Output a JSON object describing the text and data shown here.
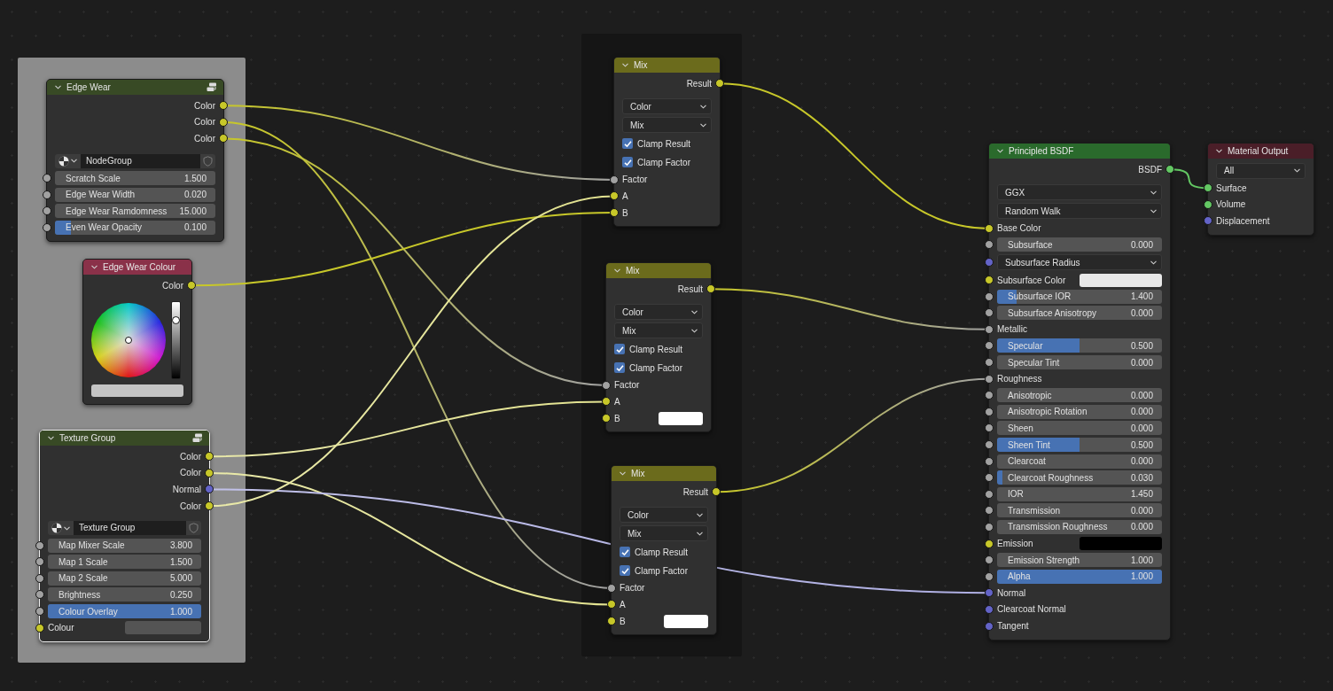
{
  "frames": [
    {
      "kind": "light"
    },
    {
      "kind": "dark"
    }
  ],
  "nodes": [
    {
      "title": "Edge Wear",
      "kind": "group",
      "selected": false,
      "group_icon": true,
      "rows": [
        {
          "kind": "output",
          "label": "Color",
          "socket": {
            "color": "#c7c729"
          }
        },
        {
          "kind": "output",
          "label": "Color",
          "socket": {
            "color": "#c7c729"
          }
        },
        {
          "kind": "output",
          "label": "Color",
          "socket": {
            "color": "#c7c729"
          }
        },
        {
          "kind": "selector",
          "name": "NodeGroup"
        },
        {
          "kind": "number",
          "label": "Scratch Scale",
          "value": "1.500",
          "socket": {
            "color": "#a1a1a1"
          }
        },
        {
          "kind": "number",
          "label": "Edge Wear Width",
          "value": "0.020",
          "socket": {
            "color": "#a1a1a1"
          }
        },
        {
          "kind": "number",
          "label": "Edge Wear Ramdomness",
          "value": "15.000",
          "socket": {
            "color": "#a1a1a1"
          }
        },
        {
          "kind": "slider",
          "label": "Even Wear Opacity",
          "value": "0.100",
          "level": 0.1,
          "socket": {
            "color": "#a1a1a1"
          }
        }
      ]
    },
    {
      "title": "Edge Wear Colour",
      "kind": "input",
      "selected": false,
      "group_icon": false,
      "rows": [
        {
          "kind": "output",
          "label": "Color",
          "socket": {
            "color": "#c7c729"
          }
        },
        {
          "kind": "wheel",
          "level": 0.75,
          "swatch": {
            "color": "#c4c4c4"
          }
        }
      ]
    },
    {
      "title": "Texture Group",
      "kind": "group",
      "selected": true,
      "group_icon": true,
      "rows": [
        {
          "kind": "output",
          "label": "Color",
          "socket": {
            "color": "#c7c729"
          }
        },
        {
          "kind": "output",
          "label": "Color",
          "socket": {
            "color": "#c7c729"
          }
        },
        {
          "kind": "output",
          "label": "Normal",
          "socket": {
            "color": "#6363c7"
          }
        },
        {
          "kind": "output",
          "label": "Color",
          "socket": {
            "color": "#c7c729"
          }
        },
        {
          "kind": "selector",
          "name": "Texture Group"
        },
        {
          "kind": "number",
          "label": "Map Mixer Scale",
          "value": "3.800",
          "socket": {
            "color": "#a1a1a1"
          }
        },
        {
          "kind": "number",
          "label": "Map 1 Scale",
          "value": "1.500",
          "socket": {
            "color": "#a1a1a1"
          }
        },
        {
          "kind": "number",
          "label": "Map 2 Scale",
          "value": "5.000",
          "socket": {
            "color": "#a1a1a1"
          }
        },
        {
          "kind": "number",
          "label": "Brightness",
          "value": "0.250",
          "socket": {
            "color": "#a1a1a1"
          }
        },
        {
          "kind": "slider",
          "label": "Colour Overlay",
          "value": "1.000",
          "level": 1.0,
          "socket": {
            "color": "#a1a1a1"
          }
        },
        {
          "kind": "color_input",
          "label": "Colour",
          "swatch": {
            "color": "#545454"
          },
          "socket": {
            "color": "#c7c729"
          }
        }
      ]
    },
    {
      "title": "Mix",
      "kind": "converter",
      "selected": false,
      "group_icon": false,
      "rows": [
        {
          "kind": "output",
          "label": "Result",
          "socket": {
            "color": "#c7c729"
          }
        },
        {
          "kind": "dropdown",
          "value": "Color"
        },
        {
          "kind": "dropdown",
          "value": "Mix"
        },
        {
          "kind": "checkbox",
          "label": "Clamp Result",
          "checked": true
        },
        {
          "kind": "checkbox",
          "label": "Clamp Factor",
          "checked": true
        },
        {
          "kind": "input",
          "label": "Factor",
          "socket": {
            "color": "#a1a1a1"
          }
        },
        {
          "kind": "input",
          "label": "A",
          "socket": {
            "color": "#c7c729"
          }
        },
        {
          "kind": "input",
          "label": "B",
          "socket": {
            "color": "#c7c729"
          }
        }
      ]
    },
    {
      "title": "Mix",
      "kind": "converter",
      "selected": false,
      "group_icon": false,
      "rows": [
        {
          "kind": "output",
          "label": "Result",
          "socket": {
            "color": "#c7c729"
          }
        },
        {
          "kind": "dropdown",
          "value": "Color"
        },
        {
          "kind": "dropdown",
          "value": "Mix"
        },
        {
          "kind": "checkbox",
          "label": "Clamp Result",
          "checked": true
        },
        {
          "kind": "checkbox",
          "label": "Clamp Factor",
          "checked": true
        },
        {
          "kind": "input",
          "label": "Factor",
          "socket": {
            "color": "#a1a1a1"
          }
        },
        {
          "kind": "input",
          "label": "A",
          "socket": {
            "color": "#c7c729"
          }
        },
        {
          "kind": "color_input",
          "label": "B",
          "swatch": {
            "color": "#ffffff"
          },
          "socket": {
            "color": "#c7c729"
          }
        }
      ]
    },
    {
      "title": "Mix",
      "kind": "converter",
      "selected": false,
      "group_icon": false,
      "rows": [
        {
          "kind": "output",
          "label": "Result",
          "socket": {
            "color": "#c7c729"
          }
        },
        {
          "kind": "dropdown",
          "value": "Color"
        },
        {
          "kind": "dropdown",
          "value": "Mix"
        },
        {
          "kind": "checkbox",
          "label": "Clamp Result",
          "checked": true
        },
        {
          "kind": "checkbox",
          "label": "Clamp Factor",
          "checked": true
        },
        {
          "kind": "input",
          "label": "Factor",
          "socket": {
            "color": "#a1a1a1"
          }
        },
        {
          "kind": "input",
          "label": "A",
          "socket": {
            "color": "#c7c729"
          }
        },
        {
          "kind": "color_input",
          "label": "B",
          "swatch": {
            "color": "#ffffff"
          },
          "socket": {
            "color": "#c7c729"
          }
        }
      ]
    },
    {
      "title": "Principled BSDF",
      "kind": "shader",
      "selected": false,
      "group_icon": false,
      "rows": [
        {
          "kind": "output",
          "label": "BSDF",
          "socket": {
            "color": "#63c763"
          }
        },
        {
          "kind": "dropdown",
          "value": "GGX"
        },
        {
          "kind": "dropdown",
          "value": "Random Walk"
        },
        {
          "kind": "input",
          "label": "Base Color",
          "socket": {
            "color": "#c7c729"
          }
        },
        {
          "kind": "number",
          "label": "Subsurface",
          "value": "0.000",
          "socket": {
            "color": "#a1a1a1"
          }
        },
        {
          "kind": "dropdown",
          "value": "Subsurface Radius",
          "socket": {
            "color": "#6363c7"
          }
        },
        {
          "kind": "color_input",
          "label": "Subsurface Color",
          "swatch": {
            "color": "#e8e8e8"
          },
          "socket": {
            "color": "#c7c729"
          }
        },
        {
          "kind": "slider",
          "label": "Subsurface IOR",
          "value": "1.400",
          "level": 0.12,
          "socket": {
            "color": "#a1a1a1"
          }
        },
        {
          "kind": "number",
          "label": "Subsurface Anisotropy",
          "value": "0.000",
          "socket": {
            "color": "#a1a1a1"
          }
        },
        {
          "kind": "input",
          "label": "Metallic",
          "socket": {
            "color": "#a1a1a1"
          }
        },
        {
          "kind": "slider",
          "label": "Specular",
          "value": "0.500",
          "level": 0.5,
          "socket": {
            "color": "#a1a1a1"
          }
        },
        {
          "kind": "number",
          "label": "Specular Tint",
          "value": "0.000",
          "socket": {
            "color": "#a1a1a1"
          }
        },
        {
          "kind": "input",
          "label": "Roughness",
          "socket": {
            "color": "#a1a1a1"
          }
        },
        {
          "kind": "number",
          "label": "Anisotropic",
          "value": "0.000",
          "socket": {
            "color": "#a1a1a1"
          }
        },
        {
          "kind": "number",
          "label": "Anisotropic Rotation",
          "value": "0.000",
          "socket": {
            "color": "#a1a1a1"
          }
        },
        {
          "kind": "number",
          "label": "Sheen",
          "value": "0.000",
          "socket": {
            "color": "#a1a1a1"
          }
        },
        {
          "kind": "slider",
          "label": "Sheen Tint",
          "value": "0.500",
          "level": 0.5,
          "socket": {
            "color": "#a1a1a1"
          }
        },
        {
          "kind": "number",
          "label": "Clearcoat",
          "value": "0.000",
          "socket": {
            "color": "#a1a1a1"
          }
        },
        {
          "kind": "slider",
          "label": "Clearcoat Roughness",
          "value": "0.030",
          "level": 0.03,
          "socket": {
            "color": "#a1a1a1"
          }
        },
        {
          "kind": "number",
          "label": "IOR",
          "value": "1.450",
          "socket": {
            "color": "#a1a1a1"
          }
        },
        {
          "kind": "number",
          "label": "Transmission",
          "value": "0.000",
          "socket": {
            "color": "#a1a1a1"
          }
        },
        {
          "kind": "number",
          "label": "Transmission Roughness",
          "value": "0.000",
          "socket": {
            "color": "#a1a1a1"
          }
        },
        {
          "kind": "color_input",
          "label": "Emission",
          "swatch": {
            "color": "#000000"
          },
          "socket": {
            "color": "#c7c729"
          }
        },
        {
          "kind": "number",
          "label": "Emission Strength",
          "value": "1.000",
          "socket": {
            "color": "#a1a1a1"
          }
        },
        {
          "kind": "slider",
          "label": "Alpha",
          "value": "1.000",
          "level": 1.0,
          "socket": {
            "color": "#a1a1a1"
          }
        },
        {
          "kind": "input",
          "label": "Normal",
          "socket": {
            "color": "#6363c7"
          }
        },
        {
          "kind": "input",
          "label": "Clearcoat Normal",
          "socket": {
            "color": "#6363c7"
          }
        },
        {
          "kind": "input",
          "label": "Tangent",
          "socket": {
            "color": "#6363c7"
          }
        }
      ]
    },
    {
      "title": "Material Output",
      "kind": "output",
      "selected": false,
      "group_icon": false,
      "rows": [
        {
          "kind": "dropdown",
          "value": "All"
        },
        {
          "kind": "input",
          "label": "Surface",
          "socket": {
            "color": "#63c763"
          }
        },
        {
          "kind": "input",
          "label": "Volume",
          "socket": {
            "color": "#63c763"
          }
        },
        {
          "kind": "input",
          "label": "Displacement",
          "socket": {
            "color": "#6363c7"
          }
        }
      ]
    }
  ]
}
